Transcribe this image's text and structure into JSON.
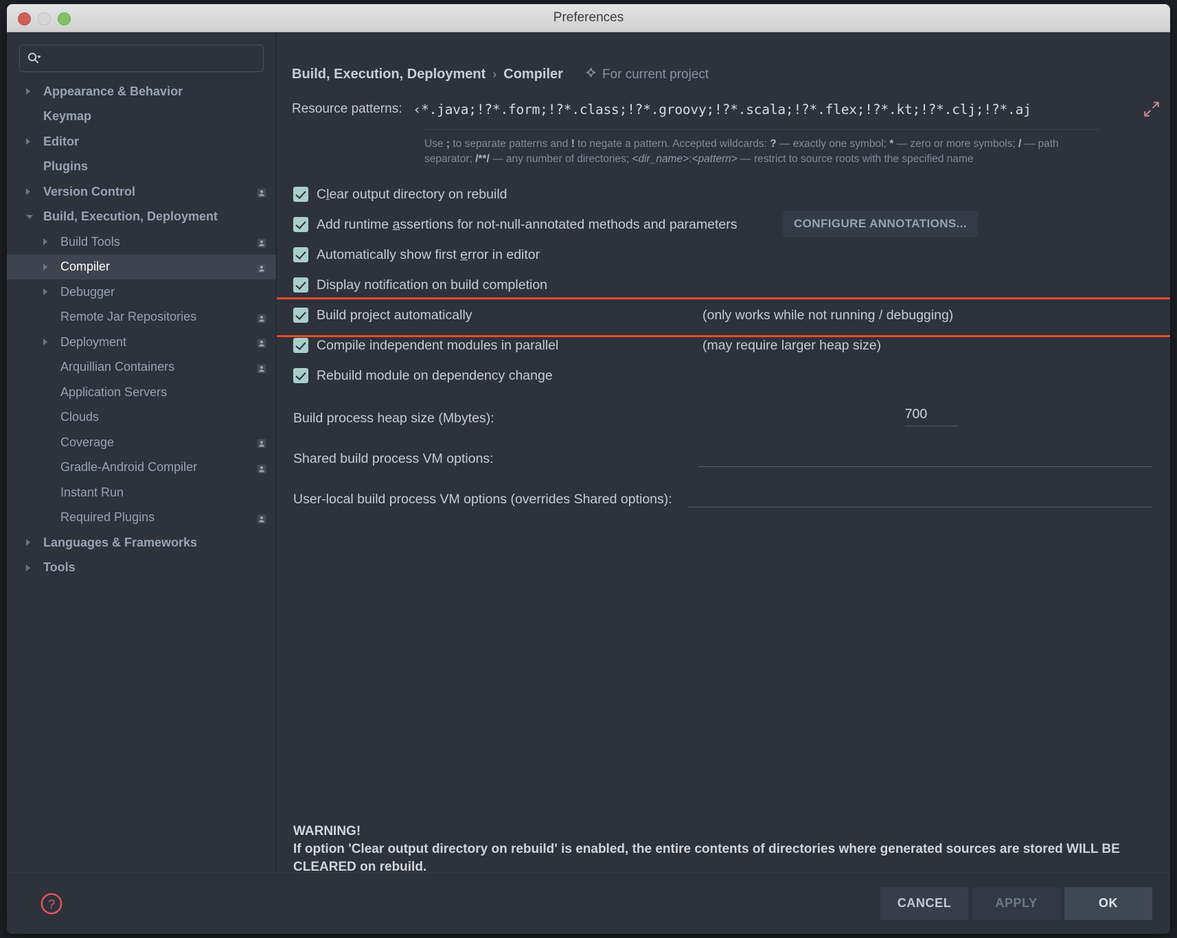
{
  "window": {
    "title": "Preferences",
    "traffic_lights": [
      "close-red",
      "minimize-yellow",
      "zoom-green"
    ]
  },
  "search": {
    "value": "",
    "placeholder": "",
    "icon": "search-icon"
  },
  "sidebar": {
    "items": [
      {
        "label": "Appearance & Behavior",
        "level": 0,
        "arrow": "collapsed",
        "badge": false,
        "selected": false
      },
      {
        "label": "Keymap",
        "level": 0,
        "arrow": "none",
        "badge": false,
        "selected": false
      },
      {
        "label": "Editor",
        "level": 0,
        "arrow": "collapsed",
        "badge": false,
        "selected": false
      },
      {
        "label": "Plugins",
        "level": 0,
        "arrow": "none",
        "badge": false,
        "selected": false
      },
      {
        "label": "Version Control",
        "level": 0,
        "arrow": "collapsed",
        "badge": true,
        "selected": false
      },
      {
        "label": "Build, Execution, Deployment",
        "level": 0,
        "arrow": "expanded",
        "badge": false,
        "selected": false
      },
      {
        "label": "Build Tools",
        "level": 1,
        "arrow": "collapsed",
        "badge": true,
        "selected": false
      },
      {
        "label": "Compiler",
        "level": 1,
        "arrow": "collapsed",
        "badge": true,
        "selected": true
      },
      {
        "label": "Debugger",
        "level": 1,
        "arrow": "collapsed",
        "badge": false,
        "selected": false
      },
      {
        "label": "Remote Jar Repositories",
        "level": 1,
        "arrow": "none",
        "badge": true,
        "selected": false
      },
      {
        "label": "Deployment",
        "level": 1,
        "arrow": "collapsed",
        "badge": true,
        "selected": false
      },
      {
        "label": "Arquillian Containers",
        "level": 1,
        "arrow": "none",
        "badge": true,
        "selected": false
      },
      {
        "label": "Application Servers",
        "level": 1,
        "arrow": "none",
        "badge": false,
        "selected": false
      },
      {
        "label": "Clouds",
        "level": 1,
        "arrow": "none",
        "badge": false,
        "selected": false
      },
      {
        "label": "Coverage",
        "level": 1,
        "arrow": "none",
        "badge": true,
        "selected": false
      },
      {
        "label": "Gradle-Android Compiler",
        "level": 1,
        "arrow": "none",
        "badge": true,
        "selected": false
      },
      {
        "label": "Instant Run",
        "level": 1,
        "arrow": "none",
        "badge": false,
        "selected": false
      },
      {
        "label": "Required Plugins",
        "level": 1,
        "arrow": "none",
        "badge": true,
        "selected": false
      },
      {
        "label": "Languages & Frameworks",
        "level": 0,
        "arrow": "collapsed",
        "badge": false,
        "selected": false
      },
      {
        "label": "Tools",
        "level": 0,
        "arrow": "collapsed",
        "badge": false,
        "selected": false
      }
    ]
  },
  "main": {
    "breadcrumb": {
      "parent": "Build, Execution, Deployment",
      "separator": "›",
      "current": "Compiler"
    },
    "scope": {
      "icon": "project-scope-icon",
      "label": "For current project"
    },
    "resource_patterns": {
      "label": "Resource patterns:",
      "value": "‹*.java;!?*.form;!?*.class;!?*.groovy;!?*.scala;!?*.flex;!?*.kt;!?*.clj;!?*.aj",
      "expand_icon": "expand-icon"
    },
    "hint": {
      "line1_a": "Use ",
      "line1_b": ";",
      "line1_c": " to separate patterns and ",
      "line1_d": "!",
      "line1_e": " to negate a pattern. Accepted wildcards: ",
      "line1_f": "?",
      "line1_g": " — exactly one symbol; ",
      "line1_h": "*",
      "line1_i": " — zero or more symbols; ",
      "line2_a": "/",
      "line2_b": " — path separator; ",
      "line2_c": "/**/",
      "line2_d": " — any number of directories; ",
      "line2_e": "<dir_name>",
      "line2_f": ":",
      "line2_g": "<pattern>",
      "line2_h": " — restrict to source roots with the specified name"
    },
    "checkboxes": [
      {
        "label_pre": "C",
        "label_mnemonic": "l",
        "label_post": "ear output directory on rebuild",
        "checked": true,
        "note": "",
        "button": ""
      },
      {
        "label_pre": "Add runtime ",
        "label_mnemonic": "a",
        "label_post": "ssertions for not-null-annotated methods and parameters",
        "checked": true,
        "note": "",
        "button": "CONFIGURE ANNOTATIONS..."
      },
      {
        "label_pre": "Automatically show first ",
        "label_mnemonic": "e",
        "label_post": "rror in editor",
        "checked": true,
        "note": "",
        "button": ""
      },
      {
        "label_pre": "Display notification on build completion",
        "label_mnemonic": "",
        "label_post": "",
        "checked": true,
        "note": "",
        "button": ""
      },
      {
        "label_pre": "Build project automatically",
        "label_mnemonic": "",
        "label_post": "",
        "checked": true,
        "note": "(only works while not running / debugging)",
        "button": "",
        "highlighted": true
      },
      {
        "label_pre": "Compile independent modules in parallel",
        "label_mnemonic": "",
        "label_post": "",
        "checked": true,
        "note": "(may require larger heap size)",
        "button": ""
      },
      {
        "label_pre": "Rebuild module on dependency change",
        "label_mnemonic": "",
        "label_post": "",
        "checked": true,
        "note": "",
        "button": ""
      }
    ],
    "fields": [
      {
        "label": "Build process heap size (Mbytes):",
        "value": "700",
        "width": "small"
      },
      {
        "label": "Shared build process VM options:",
        "value": "",
        "width": "wide"
      },
      {
        "label": "User-local build process VM options (overrides Shared options):",
        "value": "",
        "width": "wide"
      }
    ],
    "warning": {
      "title": "WARNING!",
      "body": "If option 'Clear output directory on rebuild' is enabled, the entire contents of directories where generated sources are stored WILL BE CLEARED on rebuild."
    }
  },
  "footer": {
    "help_icon": "help-icon",
    "buttons": [
      {
        "label": "CANCEL",
        "state": "normal"
      },
      {
        "label": "APPLY",
        "state": "disabled"
      },
      {
        "label": "OK",
        "state": "primary"
      }
    ]
  },
  "colors": {
    "window_bg": "#2d323b",
    "titlebar": "#dcdcdc",
    "accent_checkbox": "#a9cfc9",
    "highlight_border": "#f04a28",
    "selected_row": "#3e444e",
    "help_icon": "#e8545f",
    "expand_icon": "#c08890"
  }
}
